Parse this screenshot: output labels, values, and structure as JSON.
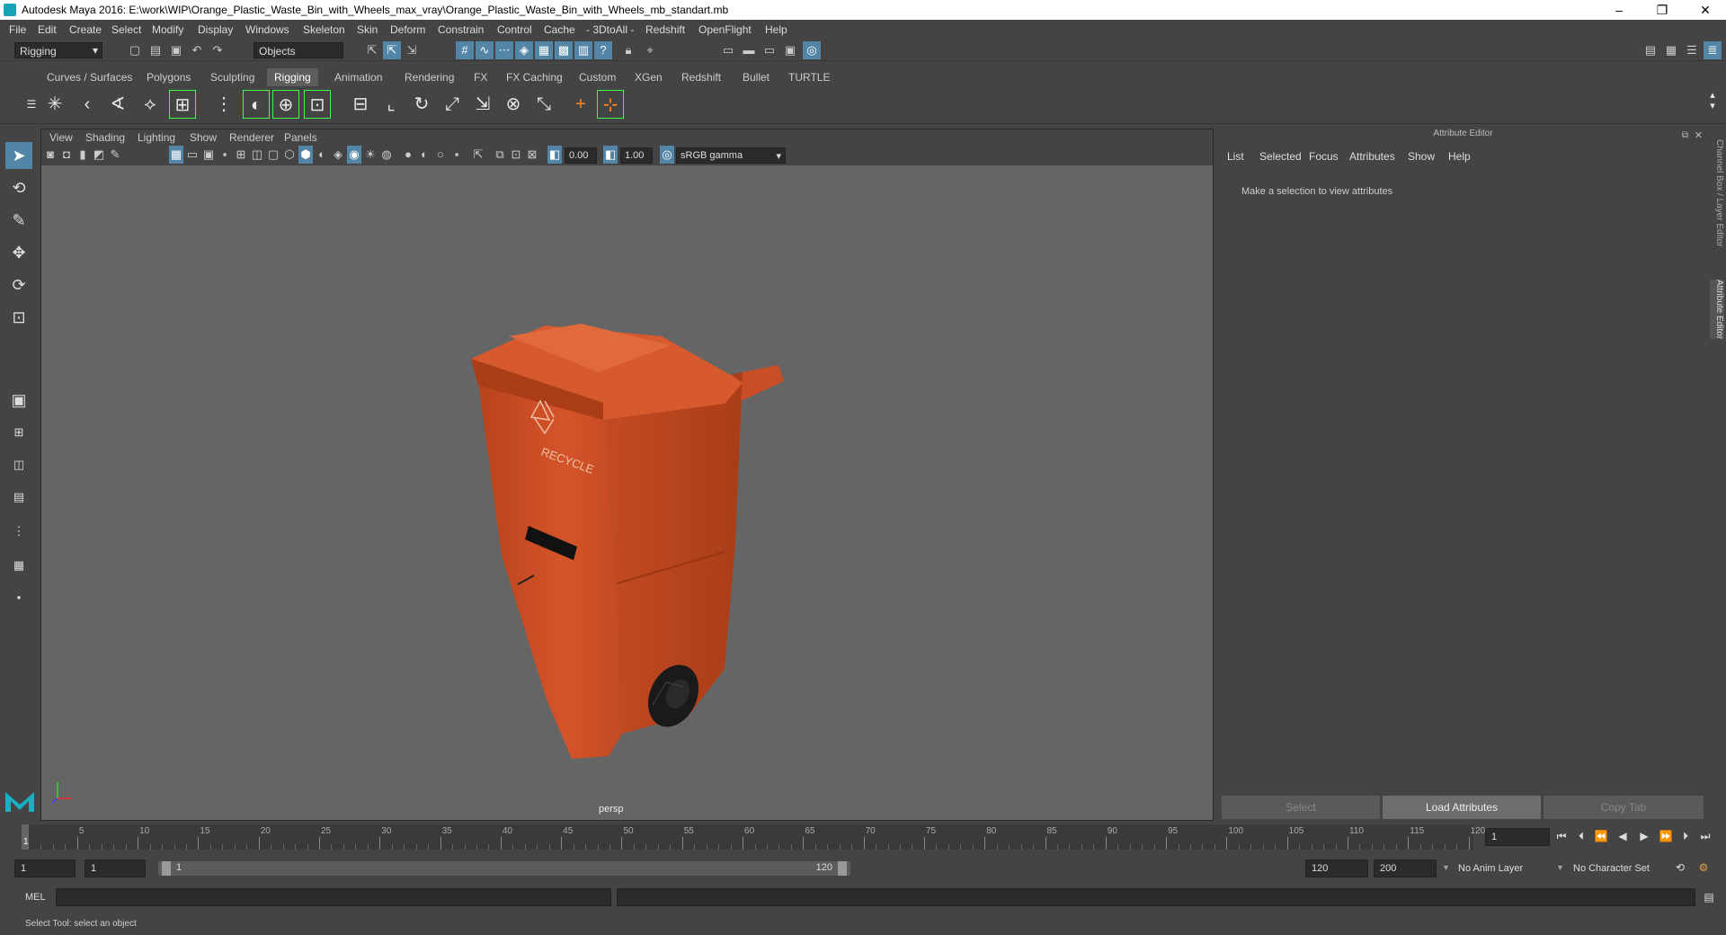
{
  "window": {
    "title": "Autodesk Maya 2016: E:\\work\\WIP\\Orange_Plastic_Waste_Bin_with_Wheels_max_vray\\Orange_Plastic_Waste_Bin_with_Wheels_mb_standart.mb",
    "minimize": "–",
    "maximize": "❐",
    "close": "✕"
  },
  "menu": [
    "File",
    "Edit",
    "Create",
    "Select",
    "Modify",
    "Display",
    "Windows",
    "Skeleton",
    "Skin",
    "Deform",
    "Constrain",
    "Control",
    "Cache",
    "- 3DtoAll -",
    "Redshift",
    "OpenFlight",
    "Help"
  ],
  "status": {
    "mode": "Rigging",
    "objects": "Objects"
  },
  "shelf_tabs": [
    "Curves / Surfaces",
    "Polygons",
    "Sculpting",
    "Rigging",
    "Animation",
    "Rendering",
    "FX",
    "FX Caching",
    "Custom",
    "XGen",
    "Redshift",
    "Bullet",
    "TURTLE"
  ],
  "active_shelf": "Rigging",
  "viewport": {
    "menu": [
      "View",
      "Shading",
      "Lighting",
      "Show",
      "Renderer",
      "Panels"
    ],
    "exposure": "0.00",
    "gamma": "1.00",
    "colorspace": "sRGB gamma",
    "camera": "persp",
    "model_label": "RECYCLE"
  },
  "attribute_editor": {
    "title": "Attribute Editor",
    "menu": [
      "List",
      "Selected",
      "Focus",
      "Attributes",
      "Show",
      "Help"
    ],
    "message": "Make a selection to view attributes",
    "buttons": [
      "Select",
      "Load Attributes",
      "Copy Tab"
    ],
    "side_tabs": [
      "Channel Box / Layer Editor",
      "Attribute Editor"
    ]
  },
  "timeline": {
    "ticks": [
      "5",
      "10",
      "15",
      "20",
      "25",
      "30",
      "35",
      "40",
      "45",
      "50",
      "55",
      "60",
      "65",
      "70",
      "75",
      "80",
      "85",
      "90",
      "95",
      "100",
      "105",
      "110",
      "115",
      "120"
    ],
    "start": "1",
    "current": "1"
  },
  "range": {
    "start": "1",
    "inner_start": "1",
    "slider_start": "1",
    "slider_end": "120",
    "end": "120",
    "max": "200",
    "anim_layer": "No Anim Layer",
    "char_set": "No Character Set"
  },
  "command": {
    "lang": "MEL"
  },
  "help_line": "Select Tool: select an object"
}
